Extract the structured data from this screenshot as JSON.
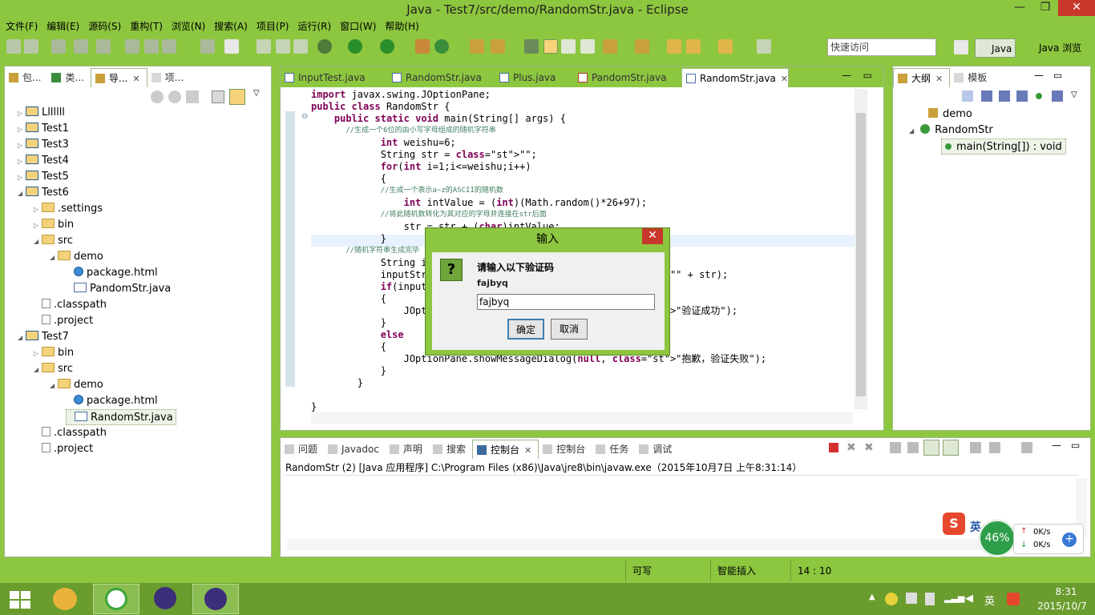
{
  "window": {
    "title": "Java  -  Test7/src/demo/RandomStr.java  -  Eclipse",
    "minimize": "—",
    "restore": "❐",
    "close": "✕"
  },
  "menu": [
    "文件(F)",
    "编辑(E)",
    "源码(S)",
    "重构(T)",
    "浏览(N)",
    "搜索(A)",
    "项目(P)",
    "运行(R)",
    "窗口(W)",
    "帮助(H)"
  ],
  "toolbar": {
    "quick_access_placeholder": "快速访问",
    "perspectives": [
      "Java",
      "Java 浏览"
    ]
  },
  "package_explorer": {
    "tabs": [
      "包...",
      "类...",
      "导...",
      "项..."
    ],
    "tree": [
      {
        "label": "Lllllll",
        "arrow": "▷",
        "icon": "project"
      },
      {
        "label": "Test1",
        "arrow": "▷",
        "icon": "project"
      },
      {
        "label": "Test3",
        "arrow": "▷",
        "icon": "project"
      },
      {
        "label": "Test4",
        "arrow": "▷",
        "icon": "project"
      },
      {
        "label": "Test5",
        "arrow": "▷",
        "icon": "project"
      },
      {
        "label": "Test6",
        "arrow": "◢",
        "icon": "project"
      },
      {
        "label": ".settings",
        "arrow": "▷",
        "icon": "folder"
      },
      {
        "label": "bin",
        "arrow": "▷",
        "icon": "folder"
      },
      {
        "label": "src",
        "arrow": "◢",
        "icon": "folder"
      },
      {
        "label": "demo",
        "arrow": "◢",
        "icon": "folder"
      },
      {
        "label": "package.html",
        "arrow": "",
        "icon": "html"
      },
      {
        "label": "PandomStr.java",
        "arrow": "",
        "icon": "java"
      },
      {
        "label": ".classpath",
        "arrow": "",
        "icon": "file"
      },
      {
        "label": ".project",
        "arrow": "",
        "icon": "file"
      },
      {
        "label": "Test7",
        "arrow": "◢",
        "icon": "project"
      },
      {
        "label": "bin",
        "arrow": "▷",
        "icon": "folder"
      },
      {
        "label": "src",
        "arrow": "◢",
        "icon": "folder"
      },
      {
        "label": "demo",
        "arrow": "◢",
        "icon": "folder"
      },
      {
        "label": "package.html",
        "arrow": "",
        "icon": "html"
      },
      {
        "label": "RandomStr.java",
        "arrow": "",
        "icon": "java"
      },
      {
        "label": ".classpath",
        "arrow": "",
        "icon": "file"
      },
      {
        "label": ".project",
        "arrow": "",
        "icon": "file"
      }
    ]
  },
  "editor": {
    "tabs": [
      "InputTest.java",
      "RandomStr.java",
      "Plus.java",
      "PandomStr.java",
      "RandomStr.java"
    ],
    "active_tab_close": "✕",
    "code_lines": [
      "import javax.swing.JOptionPane;",
      "public class RandomStr {",
      "    public static void main(String[] args) {",
      "        //生成一个6位的由小写字母组成的随机字符串",
      "            int weishu=6;",
      "            String str = \"\";",
      "            for(int i=1;i<=weishu;i++)",
      "            {",
      "                //生成一个表示a~z的ASCII的随机数",
      "                int intValue = (int)(Math.random()*26+97);",
      "                //将此随机数转化为其对应的字母并连接在str后面",
      "                str = str + (char)intValue;",
      "            }",
      "        //随机字符串生成完毕",
      "            String inputStr;",
      "            inputStr = JOptionPane.showInputDialog(\"\" + str);",
      "            if(inputStr.equals(str))",
      "            {",
      "                JOptionPane.showMessageDialog(null, \"验证成功\");",
      "            }",
      "            else",
      "            {",
      "                JOptionPane.showMessageDialog(null, \"抱歉，验证失败\");",
      "            }",
      "        }",
      "",
      "}"
    ]
  },
  "outline": {
    "tabs": [
      "大纲",
      "模板"
    ],
    "items": [
      "demo",
      "RandomStr",
      "main(String[]) : void"
    ]
  },
  "console": {
    "tabs": [
      "问题",
      "Javadoc",
      "声明",
      "搜索",
      "控制台",
      "控制台",
      "任务",
      "调试"
    ],
    "run_info": "RandomStr (2) [Java 应用程序] C:\\Program Files (x86)\\Java\\jre8\\bin\\javaw.exe（2015年10月7日 上午8:31:14）"
  },
  "status": {
    "writable": "可写",
    "insert_mode": "智能插入",
    "position": "14 : 10"
  },
  "dialog": {
    "title": "输入",
    "prompt": "请输入以下验证码",
    "code": "fajbyq",
    "input_value": "fajbyq",
    "ok": "确定",
    "cancel": "取消",
    "icon": "?"
  },
  "floater": {
    "percent": "46%",
    "up": "0K/s",
    "down": "0K/s",
    "ime": "英"
  },
  "taskbar": {
    "time": "8:31",
    "date": "2015/10/7",
    "ime": "英"
  }
}
